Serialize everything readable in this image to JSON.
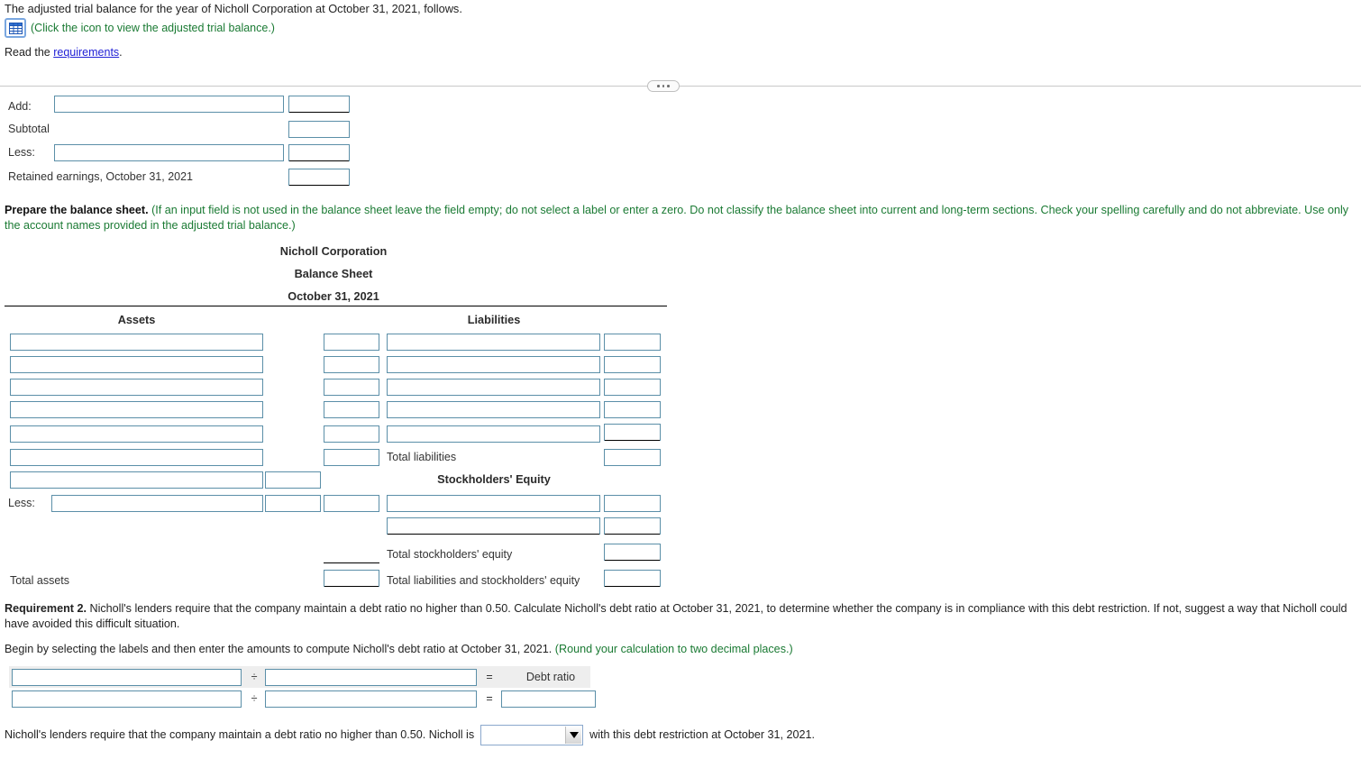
{
  "intro": {
    "line1": "The adjusted trial balance for the year of Nicholl Corporation at October 31, 2021, follows.",
    "icon_hint": "(Click the icon to view the adjusted trial balance.)",
    "icon_name": "table-grid-icon",
    "read_prefix": "Read the ",
    "read_link": "requirements",
    "read_suffix": "."
  },
  "top_table": {
    "rows": [
      {
        "label": "Add:",
        "has_text_input": true,
        "amount_rule": "double-top"
      },
      {
        "label": "Subtotal",
        "has_text_input": false,
        "amount_rule": "none"
      },
      {
        "label": "Less:",
        "has_text_input": true,
        "amount_rule": "single"
      },
      {
        "label": "Retained earnings, October 31, 2021",
        "has_text_input": false,
        "amount_rule": "double"
      }
    ]
  },
  "prepare": {
    "bold": "Prepare the balance sheet.",
    "hint": "(If an input field is not used in the balance sheet leave the field empty; do not select a label or enter a zero. Do not classify the balance sheet into current and long-term sections. Check your spelling carefully and do not abbreviate. Use only the account names provided in the adjusted trial balance.)"
  },
  "balance_sheet": {
    "company": "Nicholl Corporation",
    "statement": "Balance Sheet",
    "date": "October 31, 2021",
    "assets_header": "Assets",
    "liabilities_header": "Liabilities",
    "equity_header": "Stockholders' Equity",
    "less_label": "Less:",
    "total_assets_label": "Total assets",
    "total_liabilities_label": "Total liabilities",
    "total_equity_label": "Total stockholders' equity",
    "total_liab_equity_label": "Total liabilities and stockholders' equity"
  },
  "requirement2": {
    "bold": "Requirement 2.",
    "text": " Nicholl's lenders require that the company maintain a debt ratio no higher than 0.50. Calculate Nicholl's debt ratio at October 31, 2021, to determine whether the company is in compliance with this debt restriction. If not, suggest a way that Nicholl could have avoided this difficult situation.",
    "begin_text": "Begin by selecting the labels and then enter the amounts to compute Nicholl's debt ratio at October 31, 2021. ",
    "begin_hint": "(Round your calculation to two decimal places.)"
  },
  "ratio_table": {
    "divide_symbol": "÷",
    "equals_symbol": "=",
    "result_label": "Debt ratio",
    "row1": {
      "numerator": "",
      "denominator": "",
      "result": ""
    },
    "row2": {
      "numerator": "",
      "denominator": "",
      "result": ""
    }
  },
  "conclusion": {
    "prefix": "Nicholl's lenders require that the company maintain a debt ratio no higher than 0.50. Nicholl is",
    "select_value": "",
    "suffix": "with this debt restriction at October 31, 2021."
  },
  "colors": {
    "input_border": "#5b8fa8",
    "green_hint": "#1a7a33",
    "link": "#2121d6",
    "rule": "#000000"
  }
}
